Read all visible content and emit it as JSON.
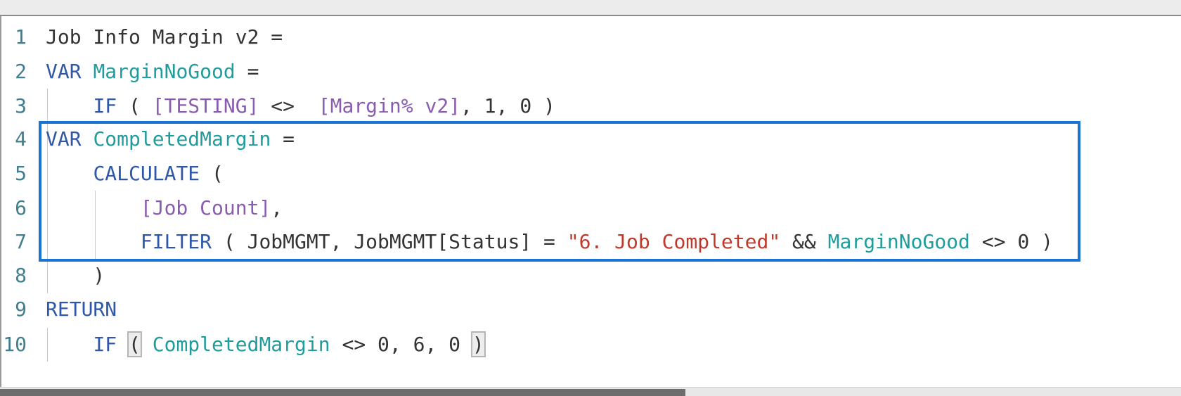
{
  "editor": {
    "highlight_color": "#1a72d2",
    "lines": [
      {
        "num": "1",
        "tokens": [
          "Job Info Margin v2 ="
        ]
      },
      {
        "num": "2",
        "tokens": [
          "VAR",
          " ",
          "MarginNoGood",
          " ="
        ]
      },
      {
        "num": "3",
        "tokens": [
          "    ",
          "IF",
          " ( ",
          "[TESTING]",
          " <>  ",
          "[Margin% v2]",
          ", 1, 0 )"
        ]
      },
      {
        "num": "4",
        "tokens": [
          "VAR",
          " ",
          "CompletedMargin",
          " ="
        ]
      },
      {
        "num": "5",
        "tokens": [
          "    ",
          "CALCULATE",
          " ("
        ]
      },
      {
        "num": "6",
        "tokens": [
          "        ",
          "[Job Count]",
          ","
        ]
      },
      {
        "num": "7",
        "tokens": [
          "        ",
          "FILTER",
          " ( JobMGMT, JobMGMT[Status] = ",
          "\"6. Job Completed\"",
          " && ",
          "MarginNoGood",
          " <> 0 )"
        ]
      },
      {
        "num": "8",
        "tokens": [
          "    )"
        ]
      },
      {
        "num": "9",
        "tokens": [
          "RETURN"
        ]
      },
      {
        "num": "10",
        "tokens": [
          "    ",
          "IF",
          " ",
          "(",
          " ",
          "CompletedMargin",
          " <> 0, 6, 0 ",
          ")"
        ]
      }
    ]
  }
}
